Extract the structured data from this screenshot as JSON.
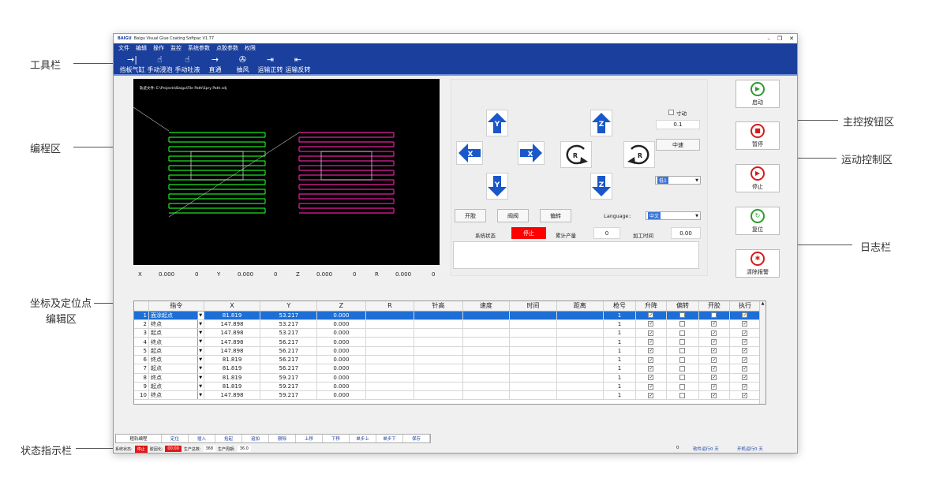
{
  "callouts": {
    "toolbar": "工具栏",
    "programming": "编程区",
    "coord_line1": "坐标及定位点",
    "coord_line2": "编辑区",
    "status": "状态指示栏",
    "main_buttons": "主控按钮区",
    "motion": "运动控制区",
    "log": "日志栏"
  },
  "window": {
    "logo": "BAIGU",
    "title": "Baigu Visual Glue Coating Softpac V1.77",
    "controls": [
      "–",
      "❐",
      "✕"
    ]
  },
  "menu": [
    "文件",
    "编辑",
    "操作",
    "监控",
    "系统参数",
    "点胶参数",
    "权限"
  ],
  "toolbar": [
    {
      "icon": "→|",
      "label": "挡板气缸",
      "icon_name": "arrow-bar-icon"
    },
    {
      "icon": "☝",
      "label": "手动浸泡",
      "icon_name": "hand-icon"
    },
    {
      "icon": "☝",
      "label": "手动吐液",
      "icon_name": "hand-icon"
    },
    {
      "icon": "→",
      "label": "直通",
      "icon_name": "arrow-right-icon"
    },
    {
      "icon": "✇",
      "label": "抽风",
      "icon_name": "fan-icon"
    },
    {
      "icon": "⇥",
      "label": "运输正转",
      "icon_name": "conveyor-forward-icon"
    },
    {
      "icon": "⇤",
      "label": "运输反转",
      "icon_name": "conveyor-reverse-icon"
    }
  ],
  "program": {
    "path_text": "轨迹文件: E:\\Projects\\Baigu\\File Path\\Spry Path.sdj"
  },
  "coords": [
    {
      "axis": "X",
      "value": "0.000",
      "zero": "0"
    },
    {
      "axis": "Y",
      "value": "0.000",
      "zero": "0"
    },
    {
      "axis": "Z",
      "value": "0.000",
      "zero": "0"
    },
    {
      "axis": "R",
      "value": "0.000",
      "zero": "0"
    }
  ],
  "motion": {
    "jog_y_up": "Y",
    "jog_y_down": "Y",
    "jog_x_left": "X",
    "jog_x_right": "X",
    "jog_z_up": "Z",
    "jog_z_down": "Z",
    "rot_ccw": "R",
    "rot_cw": "R",
    "inch_label": "寸动",
    "step_value": "0.1",
    "speed_button": "中速",
    "axis_select": "低1",
    "btn_glue": "开胶",
    "btn_valve": "阀阀",
    "btn_offset": "偏转",
    "language_label": "Language:",
    "language_value": "中文",
    "status_label": "系统状态",
    "status_value": "停止",
    "count_label": "累计产量",
    "count_value": "0",
    "time_label": "加工时间",
    "time_value": "0.00"
  },
  "main_buttons": [
    {
      "label": "启动",
      "icon": "▶",
      "color": "#2e9b2e",
      "icon_name": "play-icon"
    },
    {
      "label": "暂停",
      "icon": "■",
      "color": "#d91a1a",
      "icon_name": "pause-icon"
    },
    {
      "label": "停止",
      "icon": "▶",
      "color": "#d91a1a",
      "icon_name": "stop-icon"
    },
    {
      "label": "复位",
      "icon": "↻",
      "color": "#2e9b2e",
      "icon_name": "reset-icon"
    },
    {
      "label": "清除报警",
      "icon": "✱",
      "color": "#d91a1a",
      "icon_name": "alarm-icon"
    }
  ],
  "grid": {
    "headers": [
      "",
      "指令",
      "X",
      "Y",
      "Z",
      "R",
      "针高",
      "速度",
      "时间",
      "距离",
      "枪号",
      "升降",
      "偏转",
      "开胶",
      "执行"
    ],
    "rows": [
      {
        "n": "1",
        "cmd": "面涂起点",
        "x": "81.819",
        "y": "53.217",
        "z": "0.000",
        "gun": "1",
        "lift": true,
        "off": false,
        "glue": false,
        "exec": true
      },
      {
        "n": "2",
        "cmd": "终点",
        "x": "147.898",
        "y": "53.217",
        "z": "0.000",
        "gun": "1",
        "lift": true,
        "off": false,
        "glue": true,
        "exec": true
      },
      {
        "n": "3",
        "cmd": "起点",
        "x": "147.898",
        "y": "53.217",
        "z": "0.000",
        "gun": "1",
        "lift": true,
        "off": false,
        "glue": true,
        "exec": true
      },
      {
        "n": "4",
        "cmd": "终点",
        "x": "147.898",
        "y": "56.217",
        "z": "0.000",
        "gun": "1",
        "lift": true,
        "off": false,
        "glue": true,
        "exec": true
      },
      {
        "n": "5",
        "cmd": "起点",
        "x": "147.898",
        "y": "56.217",
        "z": "0.000",
        "gun": "1",
        "lift": true,
        "off": false,
        "glue": true,
        "exec": true
      },
      {
        "n": "6",
        "cmd": "终点",
        "x": "81.819",
        "y": "56.217",
        "z": "0.000",
        "gun": "1",
        "lift": true,
        "off": false,
        "glue": true,
        "exec": true
      },
      {
        "n": "7",
        "cmd": "起点",
        "x": "81.819",
        "y": "56.217",
        "z": "0.000",
        "gun": "1",
        "lift": true,
        "off": false,
        "glue": true,
        "exec": true
      },
      {
        "n": "8",
        "cmd": "终点",
        "x": "81.819",
        "y": "59.217",
        "z": "0.000",
        "gun": "1",
        "lift": true,
        "off": false,
        "glue": true,
        "exec": true
      },
      {
        "n": "9",
        "cmd": "起点",
        "x": "81.819",
        "y": "59.217",
        "z": "0.000",
        "gun": "1",
        "lift": true,
        "off": false,
        "glue": true,
        "exec": true
      },
      {
        "n": "10",
        "cmd": "终点",
        "x": "147.898",
        "y": "59.217",
        "z": "0.000",
        "gun": "1",
        "lift": true,
        "off": false,
        "glue": true,
        "exec": true
      }
    ]
  },
  "bottom_buttons": [
    "粗轨编程",
    "定位",
    "插入",
    "拾起",
    "追加",
    "删除",
    "上移",
    "下移",
    "单步上",
    "单步下",
    "保存"
  ],
  "statusbar": {
    "sys_label": "系统状态:",
    "sys_value": "停止",
    "cure_label": "胶固化:",
    "cure_value": "00:00",
    "total_label": "生产总数:",
    "total_value": "368",
    "cycle_label": "生产周期:",
    "cycle_value": "36.0"
  },
  "run_info": {
    "zero": "0",
    "soft_run": "软件运行0 天",
    "machine_run": "开机运行0 天"
  }
}
